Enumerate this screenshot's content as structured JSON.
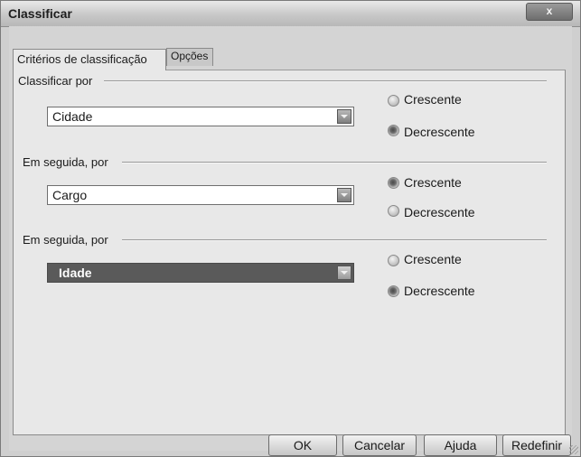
{
  "window": {
    "title": "Classificar",
    "close_label": "x"
  },
  "tabs": [
    {
      "label": "Critérios de classificação"
    },
    {
      "label": "Opções"
    }
  ],
  "groups": [
    {
      "label": "Classificar por",
      "field_value": "Cidade",
      "options": [
        {
          "label": "Crescente",
          "checked": false
        },
        {
          "label": "Decrescente",
          "checked": true
        }
      ]
    },
    {
      "label": "Em seguida, por",
      "field_value": "Cargo",
      "options": [
        {
          "label": "Crescente",
          "checked": true
        },
        {
          "label": "Decrescente",
          "checked": false
        }
      ]
    },
    {
      "label": "Em seguida, por",
      "field_value": "Idade",
      "options": [
        {
          "label": "Crescente",
          "checked": false
        },
        {
          "label": "Decrescente",
          "checked": true
        }
      ]
    }
  ],
  "buttons": {
    "ok": "OK",
    "cancel": "Cancelar",
    "help": "Ajuda",
    "reset": "Redefinir"
  }
}
